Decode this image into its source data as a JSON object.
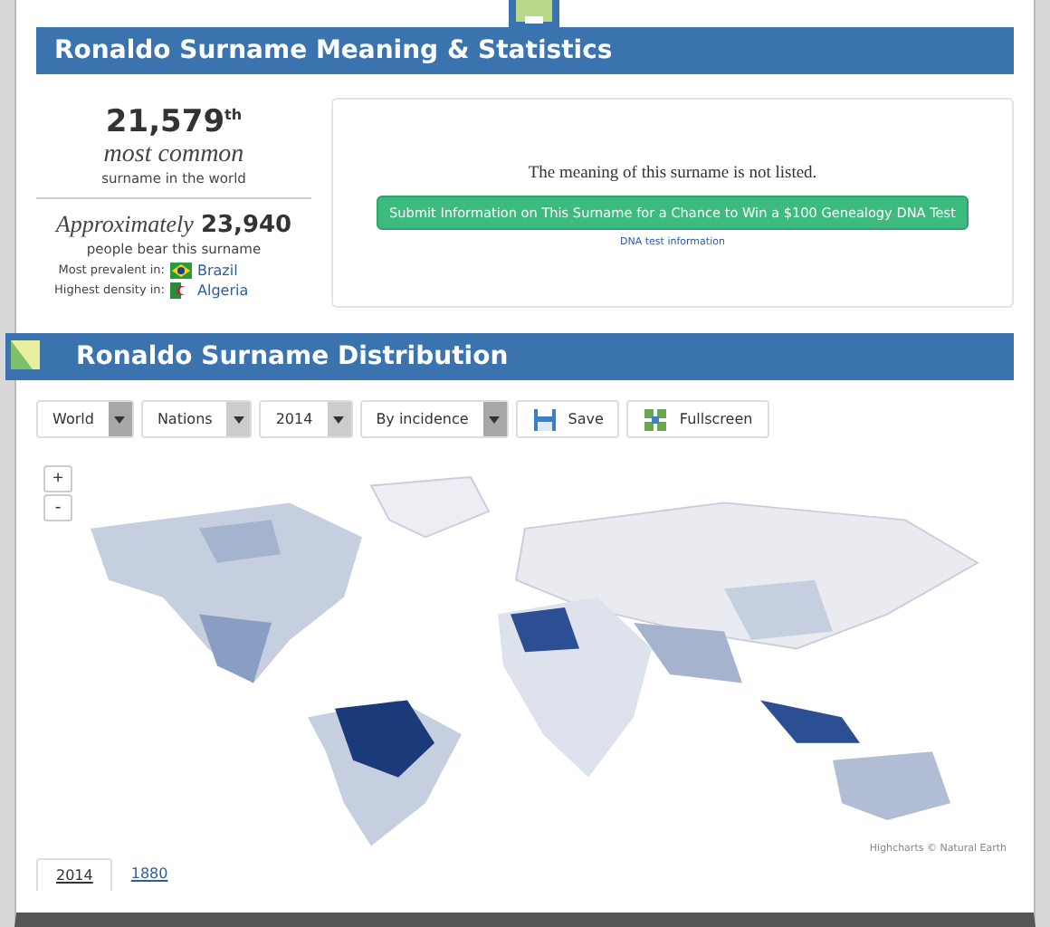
{
  "stats_header": {
    "title": "Ronaldo Surname Meaning & Statistics"
  },
  "rank": {
    "number": "21,579",
    "suffix": "th",
    "label": "most common",
    "sublabel": "surname in the world"
  },
  "population": {
    "prefix": "Approximately",
    "number": "23,940",
    "sublabel": "people bear this surname"
  },
  "locations": [
    {
      "label": "Most prevalent in:",
      "country": "Brazil"
    },
    {
      "label": "Highest density in:",
      "country": "Algeria"
    }
  ],
  "meaning": {
    "text": "The meaning of this surname is not listed.",
    "button": "Submit Information on This Surname for a Chance to Win a $100 Genealogy DNA Test",
    "link": "DNA test information"
  },
  "distribution_header": {
    "title": "Ronaldo Surname Distribution"
  },
  "controls": [
    {
      "kind": "dropdown",
      "value": "World"
    },
    {
      "kind": "dropdown",
      "value": "Nations"
    },
    {
      "kind": "dropdown",
      "value": "2014"
    },
    {
      "kind": "dropdown",
      "value": "By incidence"
    },
    {
      "kind": "button",
      "label": "Save"
    },
    {
      "kind": "button",
      "label": "Fullscreen"
    }
  ],
  "map": {
    "zoom_buttons": [
      "+",
      "-"
    ],
    "credit": "Highcharts © Natural Earth"
  },
  "year_tabs": [
    {
      "label": "2014",
      "selected": true
    },
    {
      "label": "1880",
      "selected": false
    }
  ]
}
